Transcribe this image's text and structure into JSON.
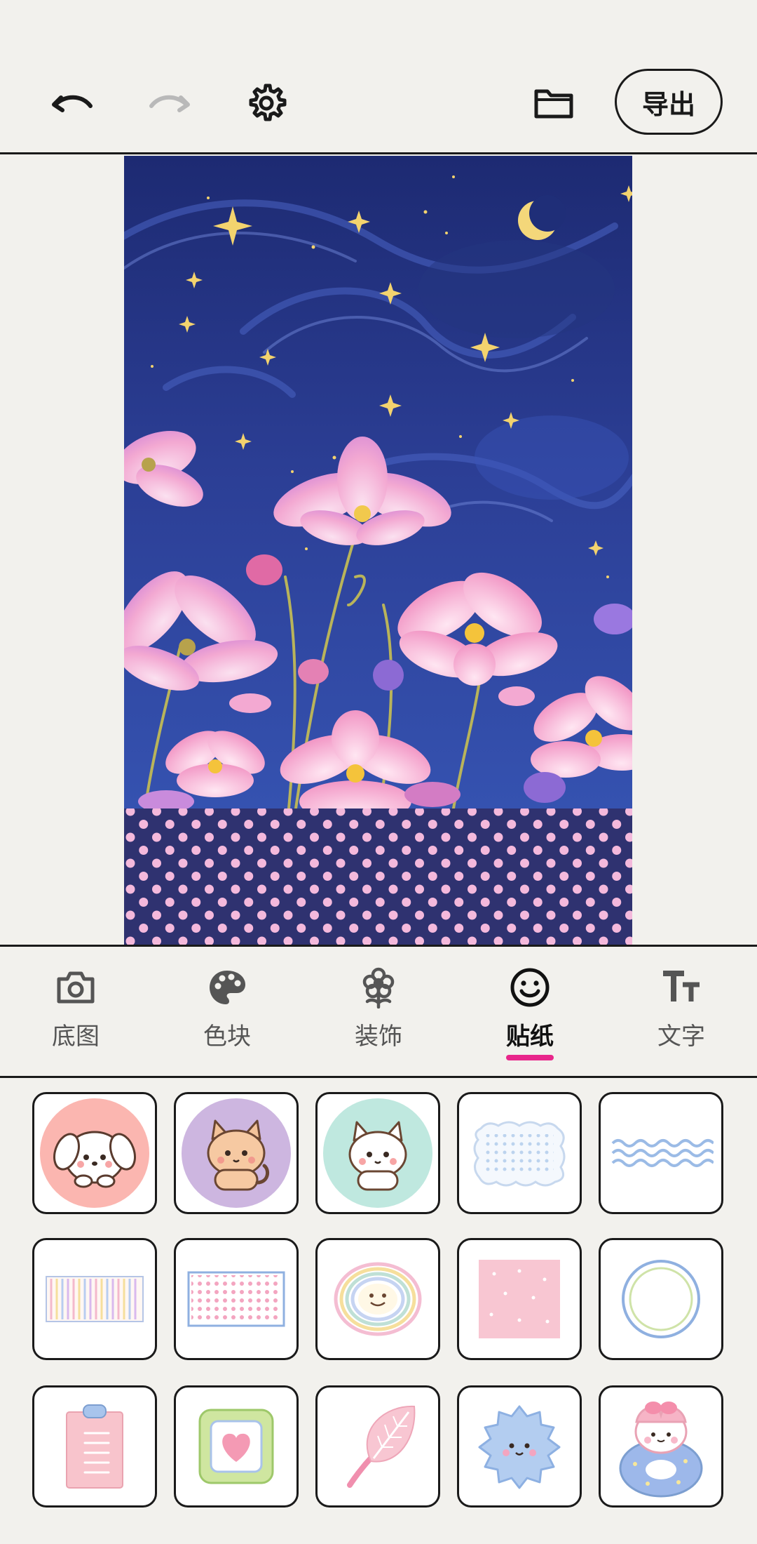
{
  "toolbar": {
    "undo_icon": "undo-icon",
    "redo_icon": "redo-icon",
    "settings_icon": "gear-icon",
    "folder_icon": "folder-icon",
    "export_label": "导出"
  },
  "tabs": [
    {
      "label": "底图",
      "icon": "camera-icon",
      "active": false
    },
    {
      "label": "色块",
      "icon": "palette-icon",
      "active": false
    },
    {
      "label": "装饰",
      "icon": "flower-icon",
      "active": false
    },
    {
      "label": "贴纸",
      "icon": "smiley-icon",
      "active": true
    },
    {
      "label": "文字",
      "icon": "text-size-icon",
      "active": false
    }
  ],
  "colors": {
    "accent": "#e8268b",
    "background": "#f2f1ed",
    "border": "#1a1a1a",
    "sky": "#2a3d8f",
    "polka_band": "#2f3270",
    "polka_dot": "#f4b9dc"
  },
  "stickers": [
    {
      "name": "puppy-pink-circle-sticker"
    },
    {
      "name": "cat-purple-circle-sticker"
    },
    {
      "name": "cat-mint-circle-sticker"
    },
    {
      "name": "dotted-cloud-frame-sticker"
    },
    {
      "name": "blue-wave-lines-sticker"
    },
    {
      "name": "pastel-stripes-sticker"
    },
    {
      "name": "pink-dot-frame-sticker"
    },
    {
      "name": "rainbow-smile-sticker"
    },
    {
      "name": "pink-dotted-square-sticker"
    },
    {
      "name": "blue-circle-frame-sticker"
    },
    {
      "name": "pink-clipboard-sticker"
    },
    {
      "name": "heart-frame-sticker"
    },
    {
      "name": "pink-leaf-sticker"
    },
    {
      "name": "blue-cloud-face-sticker"
    },
    {
      "name": "bunny-donut-sticker"
    }
  ]
}
